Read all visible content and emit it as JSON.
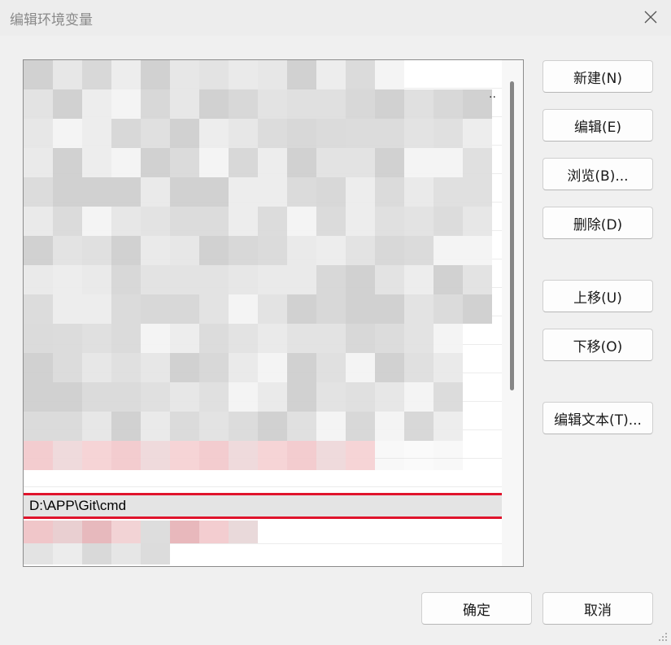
{
  "window": {
    "title": "编辑环境变量",
    "close_glyph": "✕"
  },
  "list": {
    "selected_item": "D:\\APP\\Git\\cmd",
    "truncation_mark": ".."
  },
  "buttons": {
    "new": "新建(N)",
    "edit": "编辑(E)",
    "browse": "浏览(B)...",
    "delete": "删除(D)",
    "move_up": "上移(U)",
    "move_down": "下移(O)",
    "edit_text": "编辑文本(T)...",
    "ok": "确定",
    "cancel": "取消"
  },
  "colors": {
    "highlight_border": "#e0142c",
    "dialog_background": "#f0f0f0"
  }
}
